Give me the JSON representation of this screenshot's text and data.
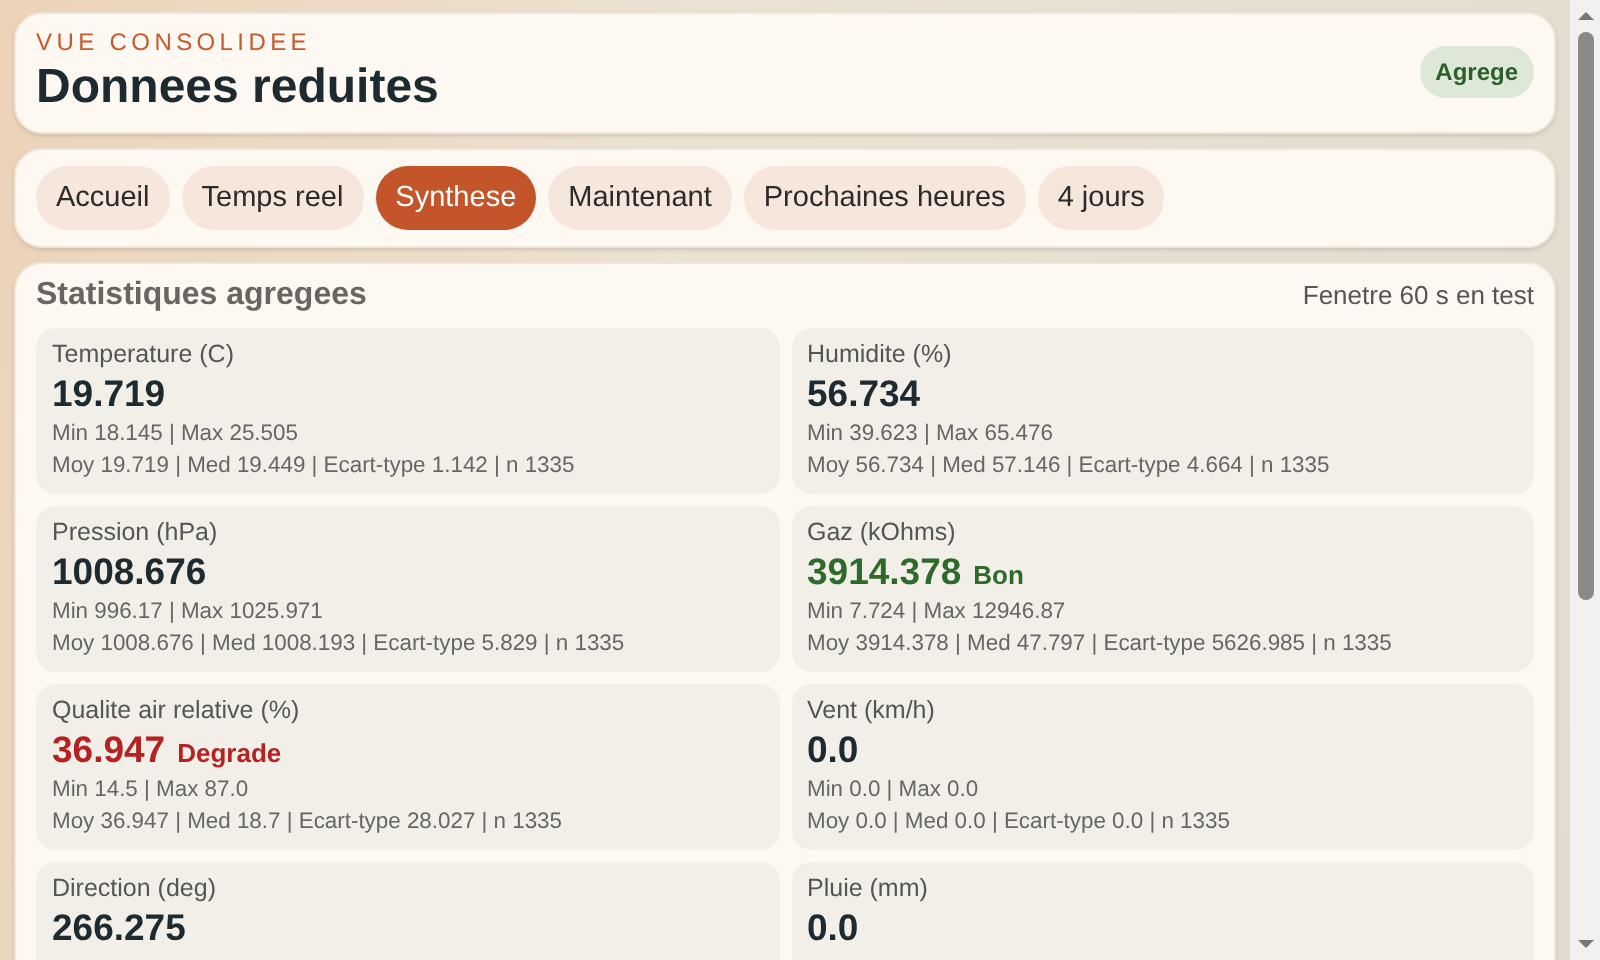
{
  "header": {
    "eyebrow": "VUE CONSOLIDEE",
    "title": "Donnees reduites",
    "badge": "Agrege"
  },
  "tabs": [
    {
      "label": "Accueil",
      "selected": false
    },
    {
      "label": "Temps reel",
      "selected": false
    },
    {
      "label": "Synthese",
      "selected": true
    },
    {
      "label": "Maintenant",
      "selected": false
    },
    {
      "label": "Prochaines heures",
      "selected": false
    },
    {
      "label": "4 jours",
      "selected": false
    }
  ],
  "stats": {
    "title": "Statistiques agregees",
    "window_note": "Fenetre 60 s en test",
    "cards": [
      {
        "label": "Temperature (C)",
        "value": "19.719",
        "kind": "neutral",
        "range": "Min 18.145 | Max 25.505",
        "summary": "Moy 19.719 | Med 19.449 | Ecart-type 1.142 | n 1335"
      },
      {
        "label": "Humidite (%)",
        "value": "56.734",
        "kind": "neutral",
        "range": "Min 39.623 | Max 65.476",
        "summary": "Moy 56.734 | Med 57.146 | Ecart-type 4.664 | n 1335"
      },
      {
        "label": "Pression (hPa)",
        "value": "1008.676",
        "kind": "neutral",
        "range": "Min 996.17 | Max 1025.971",
        "summary": "Moy 1008.676 | Med 1008.193 | Ecart-type 5.829 | n 1335"
      },
      {
        "label": "Gaz (kOhms)",
        "value": "3914.378",
        "kind": "good",
        "status": "Bon",
        "range": "Min 7.724 | Max 12946.87",
        "summary": "Moy 3914.378 | Med 47.797 | Ecart-type 5626.985 | n 1335"
      },
      {
        "label": "Qualite air relative (%)",
        "value": "36.947",
        "kind": "bad",
        "status": "Degrade",
        "range": "Min 14.5 | Max 87.0",
        "summary": "Moy 36.947 | Med 18.7 | Ecart-type 28.027 | n 1335"
      },
      {
        "label": "Vent (km/h)",
        "value": "0.0",
        "kind": "neutral",
        "range": "Min 0.0 | Max 0.0",
        "summary": "Moy 0.0 | Med 0.0 | Ecart-type 0.0 | n 1335"
      },
      {
        "label": "Direction (deg)",
        "value": "266.275",
        "kind": "neutral"
      },
      {
        "label": "Pluie (mm)",
        "value": "0.0",
        "kind": "neutral"
      }
    ]
  }
}
